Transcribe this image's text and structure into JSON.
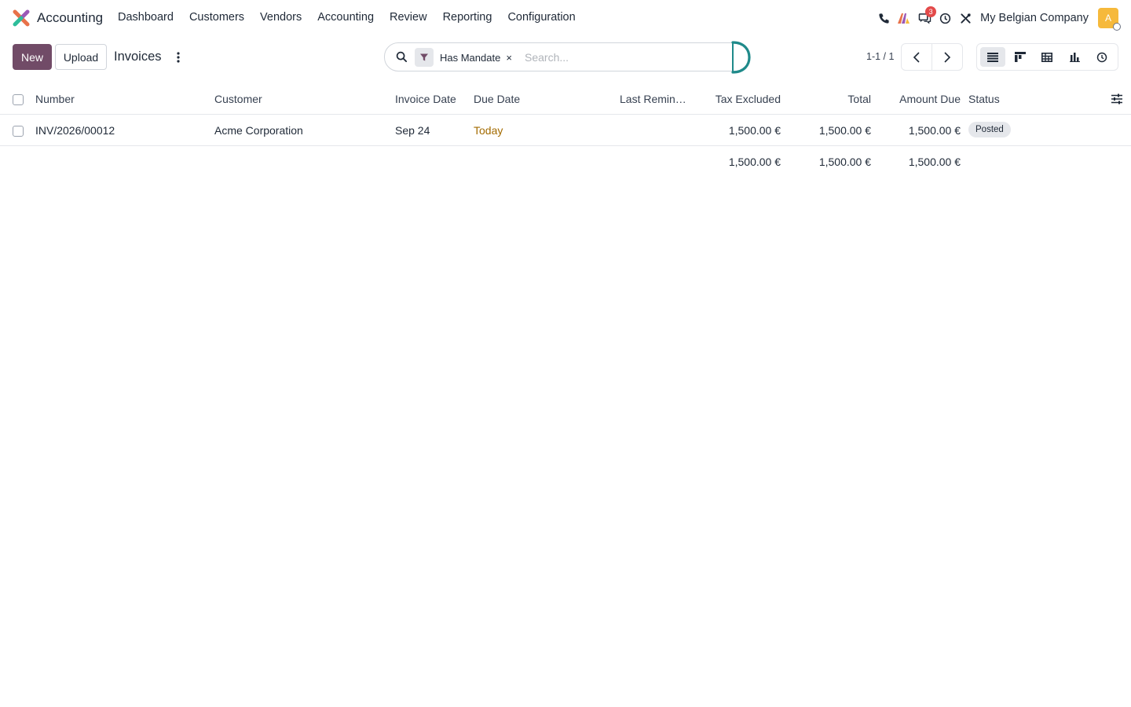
{
  "navbar": {
    "app_name": "Accounting",
    "menu": [
      "Dashboard",
      "Customers",
      "Vendors",
      "Accounting",
      "Review",
      "Reporting",
      "Configuration"
    ],
    "messages_count": "3",
    "company": "My Belgian Company",
    "avatar_initial": "A",
    "avatar_color": "#f6b93b"
  },
  "control": {
    "new_label": "New",
    "upload_label": "Upload",
    "title": "Invoices",
    "facet_label": "Has Mandate",
    "facet_close": "×",
    "search_placeholder": "Search...",
    "pager": "1-1 / 1",
    "accent_color": "#714b67"
  },
  "table": {
    "headers": {
      "number": "Number",
      "customer": "Customer",
      "invoice_date": "Invoice Date",
      "due_date": "Due Date",
      "last_reminder": "Last Remin…",
      "tax_excluded": "Tax Excluded",
      "total": "Total",
      "amount_due": "Amount Due",
      "status": "Status"
    },
    "rows": [
      {
        "number": "INV/2026/00012",
        "customer": "Acme Corporation",
        "invoice_date": "Sep 24",
        "due_date": "Today",
        "last_reminder": "",
        "tax_excluded": "1,500.00 €",
        "total": "1,500.00 €",
        "amount_due": "1,500.00 €",
        "status": "Posted"
      }
    ],
    "totals": {
      "tax_excluded": "1,500.00 €",
      "total": "1,500.00 €",
      "amount_due": "1,500.00 €"
    }
  }
}
